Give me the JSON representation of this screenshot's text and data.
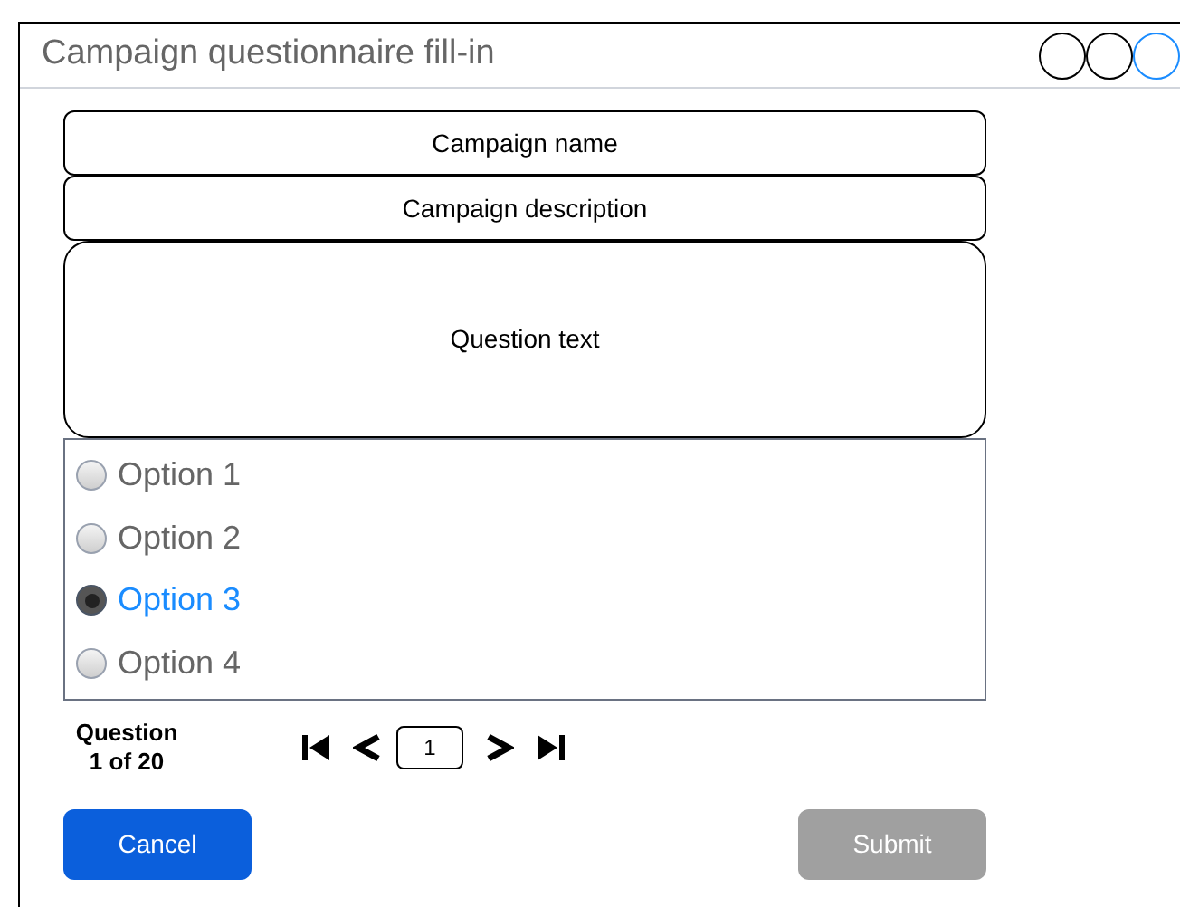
{
  "window": {
    "title": "Campaign questionnaire fill-in"
  },
  "campaign_name": "Campaign name",
  "campaign_description": "Campaign description",
  "question_text": "Question text",
  "options": [
    {
      "label": "Option 1",
      "selected": false
    },
    {
      "label": "Option 2",
      "selected": false
    },
    {
      "label": "Option 3",
      "selected": true
    },
    {
      "label": "Option 4",
      "selected": false
    }
  ],
  "pager": {
    "label": "Question",
    "position": "1 of 20",
    "page": "1"
  },
  "buttons": [
    {
      "label": "Cancel",
      "disabled": false
    },
    {
      "label": "Submit",
      "disabled": true
    }
  ]
}
